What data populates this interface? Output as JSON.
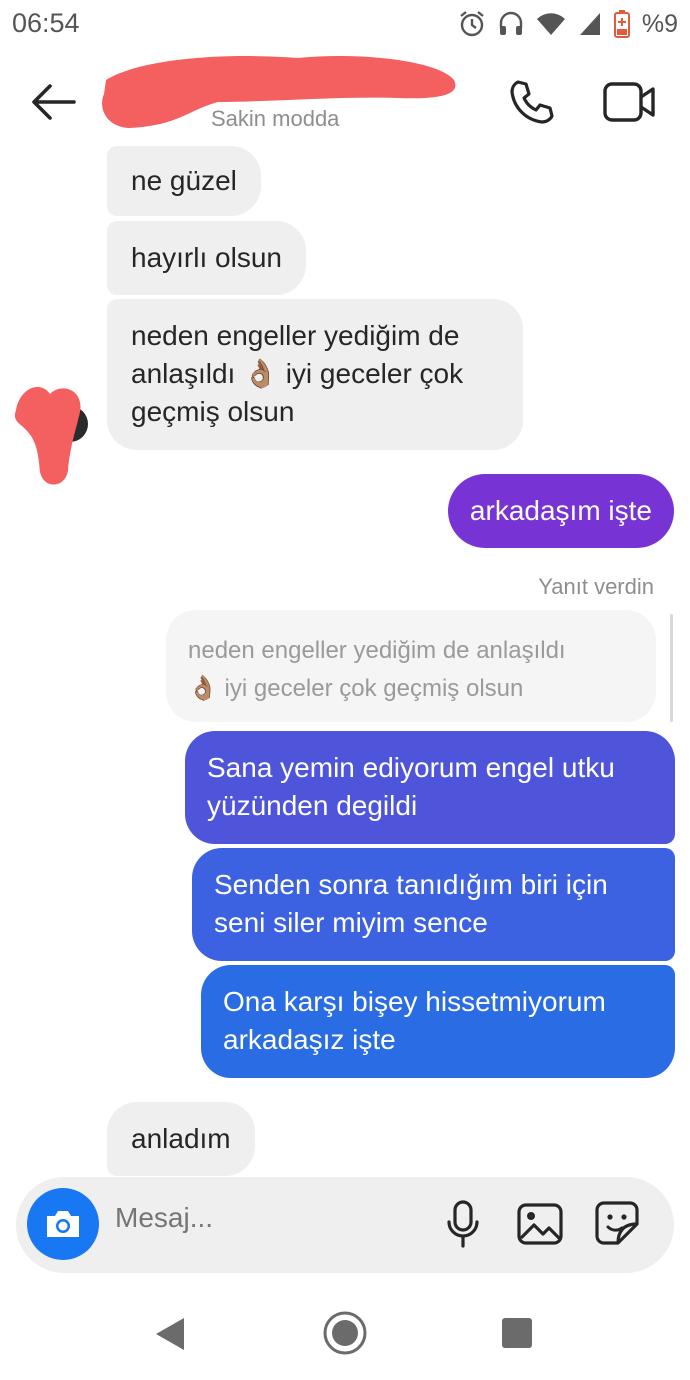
{
  "status_bar": {
    "time": "06:54",
    "battery_text": "%9",
    "icons": [
      "alarm-icon",
      "headset-icon",
      "wifi-icon",
      "signal-icon",
      "battery-icon"
    ]
  },
  "header": {
    "subtitle": "Sakin modda",
    "icons": [
      "back-arrow-icon",
      "phone-icon",
      "video-camera-icon"
    ],
    "redaction_color": "#f45f5f"
  },
  "messages": [
    {
      "side": "in",
      "text": "ne güzel"
    },
    {
      "side": "in",
      "text": "hayırlı olsun"
    },
    {
      "side": "in",
      "lines": [
        "neden engeller yediğim de",
        "anlaşıldı 👌🏽 iyi geceler çok",
        "geçmiş olsun"
      ]
    },
    {
      "side": "out",
      "text": "arkadaşım işte",
      "color": "#7733d4"
    },
    {
      "side": "out",
      "reply_label": "Yanıt verdin",
      "quoted_lines": [
        "neden engeller yediğim de anlaşıldı",
        "👌🏽 iyi geceler çok geçmiş olsun"
      ]
    },
    {
      "side": "out",
      "lines": [
        "Sana yemin ediyorum engel utku",
        "yüzünden degildi"
      ],
      "color": "#4f55db"
    },
    {
      "side": "out",
      "lines": [
        "Senden sonra tanıdığım biri için",
        "seni siler miyim sence"
      ],
      "color": "#3d62e1"
    },
    {
      "side": "out",
      "lines": [
        "Ona karşı bişey hissetmiyorum",
        "arkadaşız işte"
      ],
      "color": "#2a6ce3"
    },
    {
      "side": "in",
      "text": "anladım"
    }
  ],
  "composer": {
    "placeholder": "Mesaj...",
    "icons": [
      "camera-icon",
      "microphone-icon",
      "gallery-icon",
      "sticker-icon"
    ],
    "accent": "#1877f2"
  },
  "nav_bar": {
    "icons": [
      "nav-back-icon",
      "nav-home-icon",
      "nav-recents-icon"
    ]
  }
}
